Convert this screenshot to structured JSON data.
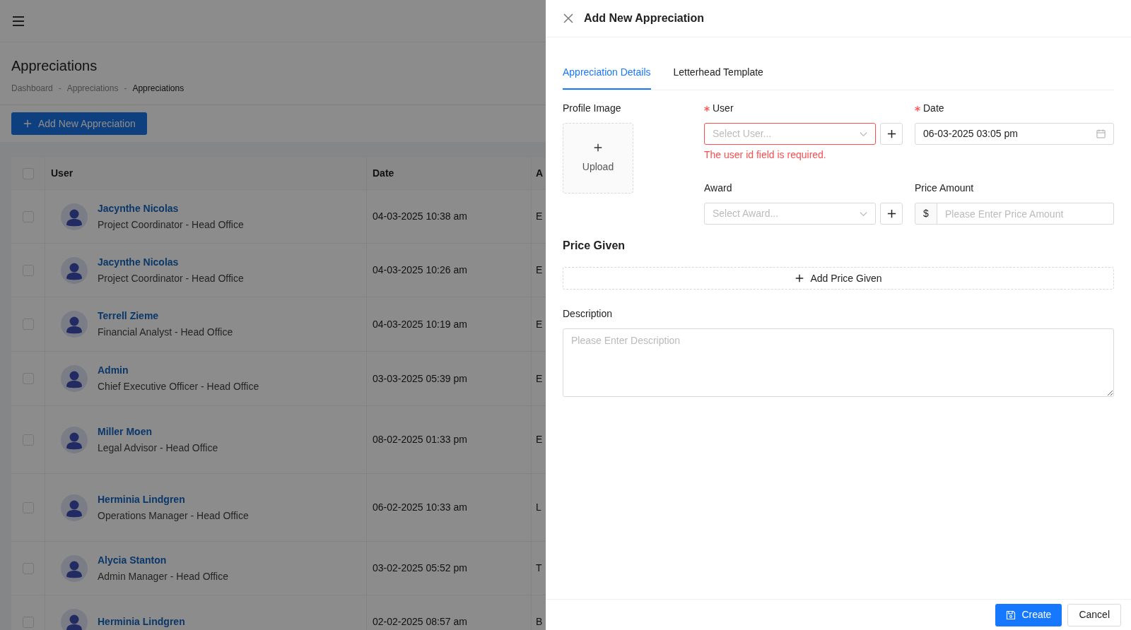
{
  "page": {
    "title": "Appreciations",
    "breadcrumb": [
      "Dashboard",
      "Appreciations",
      "Appreciations"
    ],
    "breadcrumb_separator": "-",
    "add_button": "Add New Appreciation"
  },
  "table": {
    "columns": [
      "User",
      "Date",
      "A"
    ],
    "header_checked": false,
    "rows": [
      {
        "checked": false,
        "name": "Jacynthe Nicolas",
        "role": "Project Coordinator - Head Office",
        "date": "04-03-2025 10:38 am",
        "column_3": "E"
      },
      {
        "checked": false,
        "name": "Jacynthe Nicolas",
        "role": "Project Coordinator - Head Office",
        "date": "04-03-2025 10:26 am",
        "column_3": "E"
      },
      {
        "checked": false,
        "name": "Terrell Zieme",
        "role": "Financial Analyst - Head Office",
        "date": "04-03-2025 10:19 am",
        "column_3": "E"
      },
      {
        "checked": false,
        "name": "Admin",
        "role": "Chief Executive Officer - Head Office",
        "date": "03-03-2025 05:39 pm",
        "column_3": "E"
      },
      {
        "checked": false,
        "name": "Miller Moen",
        "role": "Legal Advisor - Head Office",
        "date": "08-02-2025 01:33 pm",
        "column_3": "E"
      },
      {
        "checked": false,
        "name": "Herminia Lindgren",
        "role": "Operations Manager - Head Office",
        "date": "06-02-2025 10:33 am",
        "column_3": "L"
      },
      {
        "checked": false,
        "name": "Alycia Stanton",
        "role": "Admin Manager - Head Office",
        "date": "03-02-2025 05:52 pm",
        "column_3": "T"
      },
      {
        "checked": false,
        "name": "Herminia Lindgren",
        "date": "02-02-2025 08:57 am",
        "column_3": "B"
      }
    ]
  },
  "drawer": {
    "title": "Add New Appreciation",
    "tabs": [
      {
        "label": "Appreciation Details",
        "selected": true
      },
      {
        "label": "Letterhead Template",
        "selected": false
      }
    ],
    "profile_image": {
      "label": "Profile Image",
      "upload": "Upload"
    },
    "user": {
      "label": "User",
      "required": true,
      "placeholder": "Select User...",
      "error": "The user id field is required."
    },
    "date": {
      "label": "Date",
      "required": true,
      "value": "06-03-2025 03:05 pm"
    },
    "award": {
      "label": "Award",
      "placeholder": "Select Award..."
    },
    "price_amount": {
      "label": "Price Amount",
      "prefix": "$",
      "placeholder": "Please Enter Price Amount"
    },
    "price_given": {
      "heading": "Price Given",
      "add_button": "Add Price Given"
    },
    "description": {
      "label": "Description",
      "placeholder": "Please Enter Description"
    },
    "buttons": {
      "create": "Create",
      "cancel": "Cancel"
    }
  }
}
